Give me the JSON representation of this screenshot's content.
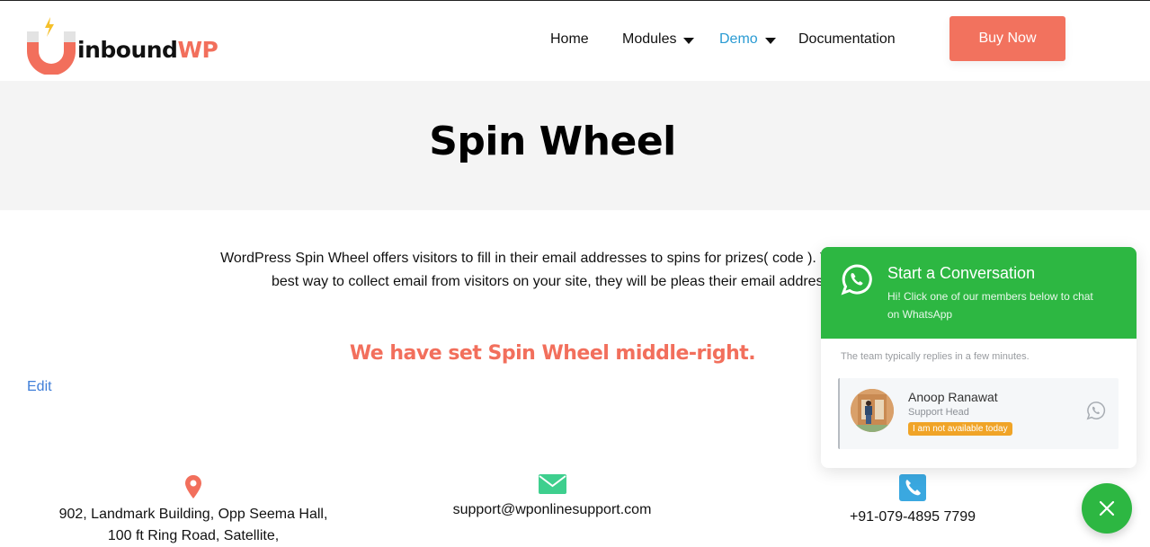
{
  "header": {
    "logo": {
      "text_primary": "inbound",
      "text_accent": "WP"
    },
    "nav": [
      {
        "label": "Home",
        "has_dropdown": false,
        "active": false
      },
      {
        "label": "Modules",
        "has_dropdown": true,
        "active": false
      },
      {
        "label": "Demo",
        "has_dropdown": true,
        "active": true
      },
      {
        "label": "Documentation",
        "has_dropdown": false,
        "active": false
      }
    ],
    "cta_label": "Buy Now"
  },
  "page": {
    "title": "Spin Wheel",
    "intro": "WordPress Spin Wheel offers visitors to fill in their email addresses to spins for prizes( code ). This is the best way to collect email from visitors on your site, they will be pleas their email address.",
    "highlight": "We have set Spin Wheel middle-right.",
    "edit_label": "Edit"
  },
  "contact": {
    "address_icon": "map-pin-icon",
    "address_line1": "902, Landmark Building, Opp Seema Hall,",
    "address_line2": "100 ft Ring Road, Satellite,",
    "email_icon": "envelope-icon",
    "email": "support@wponlinesupport.com",
    "phone_icon": "phone-icon",
    "phone": "+91-079-4895 7799"
  },
  "whatsapp": {
    "title": "Start a Conversation",
    "subtitle": "Hi! Click one of our members below to chat on WhatsApp",
    "note": "The team typically replies in a few minutes.",
    "members": [
      {
        "name": "Anoop Ranawat",
        "role": "Support Head",
        "status": "I am not available today"
      }
    ],
    "close_icon": "close-icon"
  },
  "colors": {
    "brand_coral": "#f26f5c",
    "link_blue": "#2a9bd3",
    "whatsapp_green": "#2db742",
    "badge_orange": "#f0a427",
    "mail_green": "#3ecf8e",
    "phone_blue": "#3aa8e0"
  }
}
